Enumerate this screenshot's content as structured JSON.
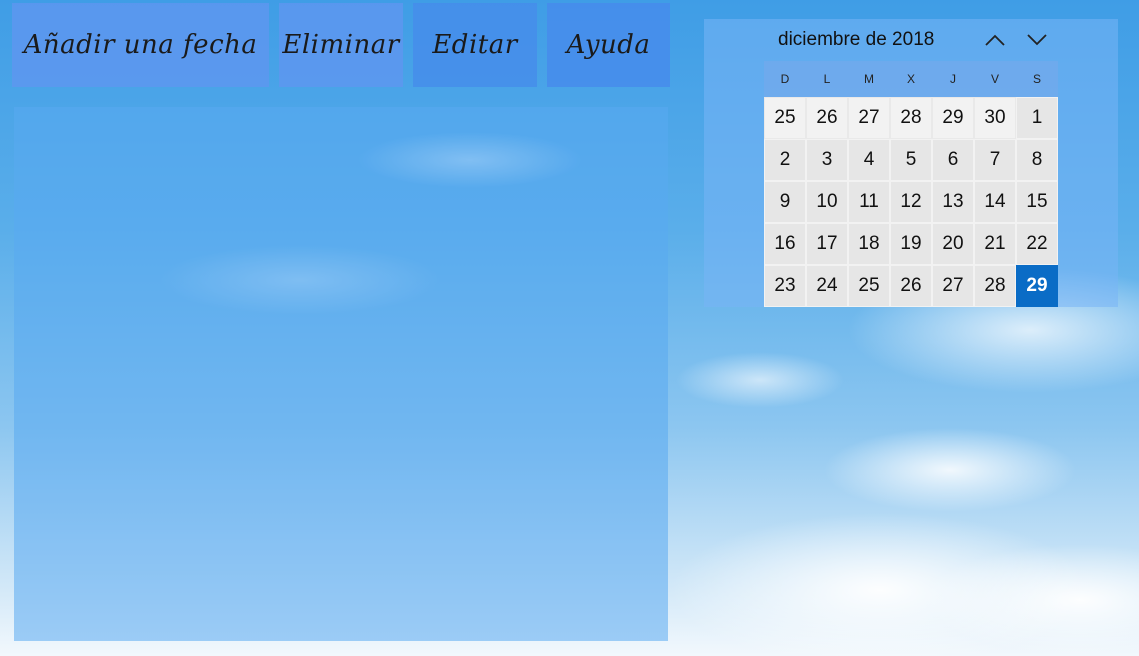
{
  "toolbar": {
    "add_label": "Añadir una fecha",
    "delete_label": "Eliminar",
    "edit_label": "Editar",
    "help_label": "Ayuda"
  },
  "calendar": {
    "month_label": "diciembre de 2018",
    "prev_icon": "chevron-up-icon",
    "next_icon": "chevron-down-icon",
    "weekdays": [
      "D",
      "L",
      "M",
      "X",
      "J",
      "V",
      "S"
    ],
    "today_color": "#0a6cc6",
    "weeks": [
      [
        {
          "day": "25",
          "other": true
        },
        {
          "day": "26",
          "other": true
        },
        {
          "day": "27",
          "other": true
        },
        {
          "day": "28",
          "other": true
        },
        {
          "day": "29",
          "other": true
        },
        {
          "day": "30",
          "other": true
        },
        {
          "day": "1"
        }
      ],
      [
        {
          "day": "2"
        },
        {
          "day": "3"
        },
        {
          "day": "4"
        },
        {
          "day": "5"
        },
        {
          "day": "6"
        },
        {
          "day": "7"
        },
        {
          "day": "8"
        }
      ],
      [
        {
          "day": "9"
        },
        {
          "day": "10"
        },
        {
          "day": "11"
        },
        {
          "day": "12"
        },
        {
          "day": "13"
        },
        {
          "day": "14"
        },
        {
          "day": "15"
        }
      ],
      [
        {
          "day": "16"
        },
        {
          "day": "17"
        },
        {
          "day": "18"
        },
        {
          "day": "19"
        },
        {
          "day": "20"
        },
        {
          "day": "21"
        },
        {
          "day": "22"
        }
      ],
      [
        {
          "day": "23"
        },
        {
          "day": "24"
        },
        {
          "day": "25"
        },
        {
          "day": "26"
        },
        {
          "day": "27"
        },
        {
          "day": "28"
        },
        {
          "day": "29",
          "today": true
        }
      ]
    ]
  }
}
